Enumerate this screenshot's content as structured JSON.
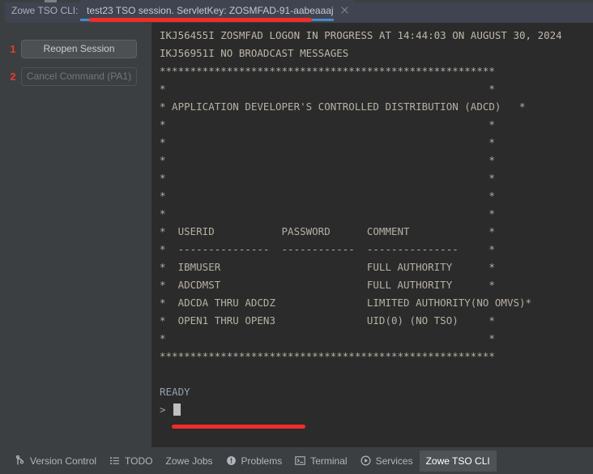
{
  "window": {
    "cli_label": "Zowe TSO CLI:"
  },
  "tab": {
    "title": "test23 TSO session. ServletKey: ZOSMFAD-91-aabeaaaj",
    "close_icon": "close-icon"
  },
  "sidebar": {
    "buttons": [
      {
        "marker": "1",
        "label": "Reopen Session",
        "enabled": true
      },
      {
        "marker": "2",
        "label": "Cancel Command (PA1)",
        "enabled": false
      }
    ]
  },
  "terminal": {
    "lines": [
      "IKJ56455I ZOSMFAD LOGON IN PROGRESS AT 14:44:03 ON AUGUST 30, 2024",
      "IKJ56951I NO BROADCAST MESSAGES",
      "*******************************************************",
      "*                                                     *",
      "* APPLICATION DEVELOPER'S CONTROLLED DISTRIBUTION (ADCD)   *",
      "*                                                     *",
      "*                                                     *",
      "*                                                     *",
      "*                                                     *",
      "*                                                     *",
      "*                                                     *",
      "*  USERID           PASSWORD      COMMENT             *",
      "*  ---------------  ------------  ---------------     *",
      "*  IBMUSER                        FULL AUTHORITY      *",
      "*  ADCDMST                        FULL AUTHORITY      *",
      "*  ADCDA THRU ADCDZ               LIMITED AUTHORITY(NO OMVS)*",
      "*  OPEN1 THRU OPEN3               UID(0) (NO TSO)     *",
      "*                                                     *",
      "*******************************************************",
      "",
      "READY"
    ],
    "prompt": ">",
    "cursor": "block-cursor"
  },
  "statusbar": {
    "items": [
      {
        "label": "Version Control",
        "icon": "branch-icon",
        "active": false
      },
      {
        "label": "TODO",
        "icon": "list-icon",
        "active": false
      },
      {
        "label": "Zowe Jobs",
        "icon": "none",
        "active": false
      },
      {
        "label": "Problems",
        "icon": "warning-icon",
        "active": false
      },
      {
        "label": "Terminal",
        "icon": "terminal-icon",
        "active": false
      },
      {
        "label": "Services",
        "icon": "play-icon",
        "active": false
      },
      {
        "label": "Zowe TSO CLI",
        "icon": "none",
        "active": true
      }
    ]
  },
  "colors": {
    "annotation_red": "#f22c26",
    "tab_selected_blue": "#4a88c7",
    "terminal_bg": "#2b2b2b",
    "panel_bg": "#3c3f41"
  }
}
